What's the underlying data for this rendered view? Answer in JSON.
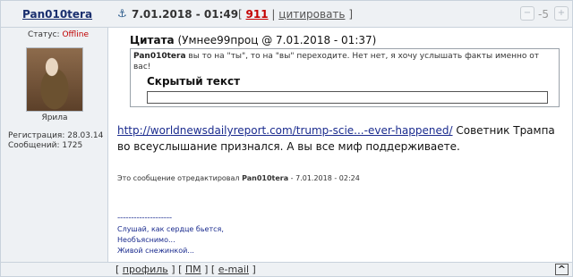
{
  "header": {
    "author": "Pan010tera",
    "anchor_icon": "anchor-icon",
    "date": "7.01.2018 - 01:49",
    "bracket_open": "[",
    "post_number": "911",
    "separator": "|",
    "quote_label": "цитировать",
    "bracket_close": "]",
    "rating": "-5"
  },
  "sidebar": {
    "status_label": "Статус:",
    "status_value": "Offline",
    "rank": "Ярила",
    "registration": "Регистрация: 28.03.14",
    "messages": "Сообщений: 1725"
  },
  "quote": {
    "label": "Цитата",
    "meta": "(Умнее99проц @ 7.01.2018 - 01:37)",
    "author": "Pan010tera",
    "text": " вы то на \"ты\", то на \"вы\" переходите. Нет нет, я хочу услышать факты именно от вас!",
    "hidden_label": "Скрытый текст"
  },
  "message": {
    "link": "http://worldnewsdailyreport.com/trump-scie...-ever-happened/",
    "text": " Советник Трампа во всеуслышание признался. А вы все миф поддерживаете."
  },
  "edited": {
    "prefix": "Это сообщение отредактировал ",
    "author": "Pan010tera",
    "suffix": " - 7.01.2018 - 02:24"
  },
  "signature": {
    "separator": "--------------------",
    "line1": "Слушай, как сердце бьется,",
    "line2": "Необъяснимо...",
    "line3": "Живой снежинкой..."
  },
  "footer": {
    "profile": "профиль",
    "pm": "ПМ",
    "email": "e-mail",
    "totop": "^"
  }
}
